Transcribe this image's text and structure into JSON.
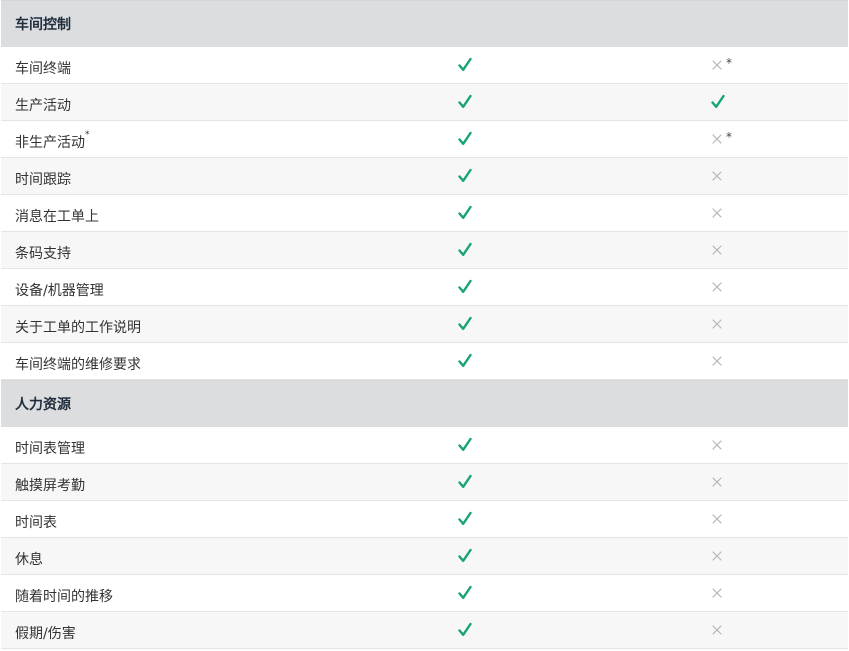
{
  "colors": {
    "check": "#1aa37a",
    "cross": "#b5b5b5",
    "header_bg": "#dcdddf"
  },
  "sections": [
    {
      "title": "车间控制",
      "rows": [
        {
          "label": "车间终端",
          "col1": "check",
          "col2": "cross",
          "col2_note": "*"
        },
        {
          "label": "生产活动",
          "col1": "check",
          "col2": "check"
        },
        {
          "label": "非生产活动",
          "label_sup": "*",
          "col1": "check",
          "col2": "cross",
          "col2_note": "*"
        },
        {
          "label": "时间跟踪",
          "col1": "check",
          "col2": "cross"
        },
        {
          "label": "消息在工单上",
          "col1": "check",
          "col2": "cross"
        },
        {
          "label": "条码支持",
          "col1": "check",
          "col2": "cross"
        },
        {
          "label": "设备/机器管理",
          "col1": "check",
          "col2": "cross"
        },
        {
          "label": "关于工单的工作说明",
          "col1": "check",
          "col2": "cross"
        },
        {
          "label": "车间终端的维修要求",
          "col1": "check",
          "col2": "cross"
        }
      ]
    },
    {
      "title": "人力资源",
      "rows": [
        {
          "label": "时间表管理",
          "col1": "check",
          "col2": "cross"
        },
        {
          "label": "触摸屏考勤",
          "col1": "check",
          "col2": "cross"
        },
        {
          "label": "时间表",
          "col1": "check",
          "col2": "cross"
        },
        {
          "label": "休息",
          "col1": "check",
          "col2": "cross"
        },
        {
          "label": "随着时间的推移",
          "col1": "check",
          "col2": "cross"
        },
        {
          "label": "假期/伤害",
          "col1": "check",
          "col2": "cross"
        }
      ]
    }
  ]
}
